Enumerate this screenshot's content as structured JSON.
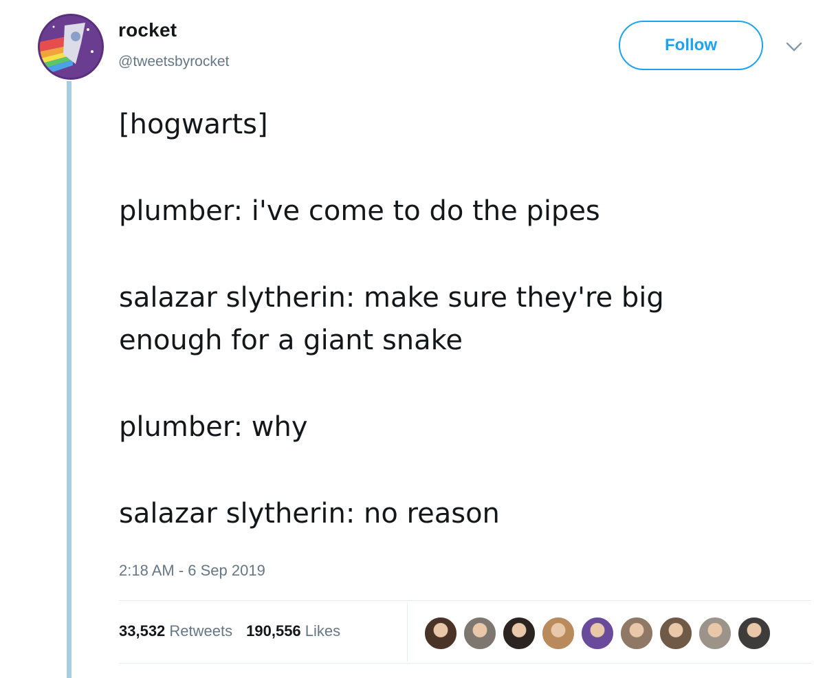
{
  "tweet": {
    "author": {
      "display_name": "rocket",
      "handle": "@tweetsbyrocket"
    },
    "follow_label": "Follow",
    "text_lines": [
      "[hogwarts]",
      "plumber: i've come to do the pipes",
      "salazar slytherin: make sure they're big",
      "enough for a giant snake",
      "plumber: why",
      "salazar slytherin: no reason"
    ],
    "timestamp": "2:18 AM - 6 Sep 2019",
    "stats": {
      "retweets_count": "33,532",
      "retweets_label": "Retweets",
      "likes_count": "190,556",
      "likes_label": "Likes"
    },
    "likers": [
      {
        "color": "#4a3428"
      },
      {
        "color": "#7d7770"
      },
      {
        "color": "#2c2420"
      },
      {
        "color": "#b88a5c"
      },
      {
        "color": "#6a4a9a"
      },
      {
        "color": "#8f7866"
      },
      {
        "color": "#6f5a48"
      },
      {
        "color": "#9c948a"
      },
      {
        "color": "#3f3d3c"
      }
    ]
  },
  "colors": {
    "accent": "#1da1f2",
    "secondary_text": "#657786",
    "thread_line": "#a9cde0"
  }
}
